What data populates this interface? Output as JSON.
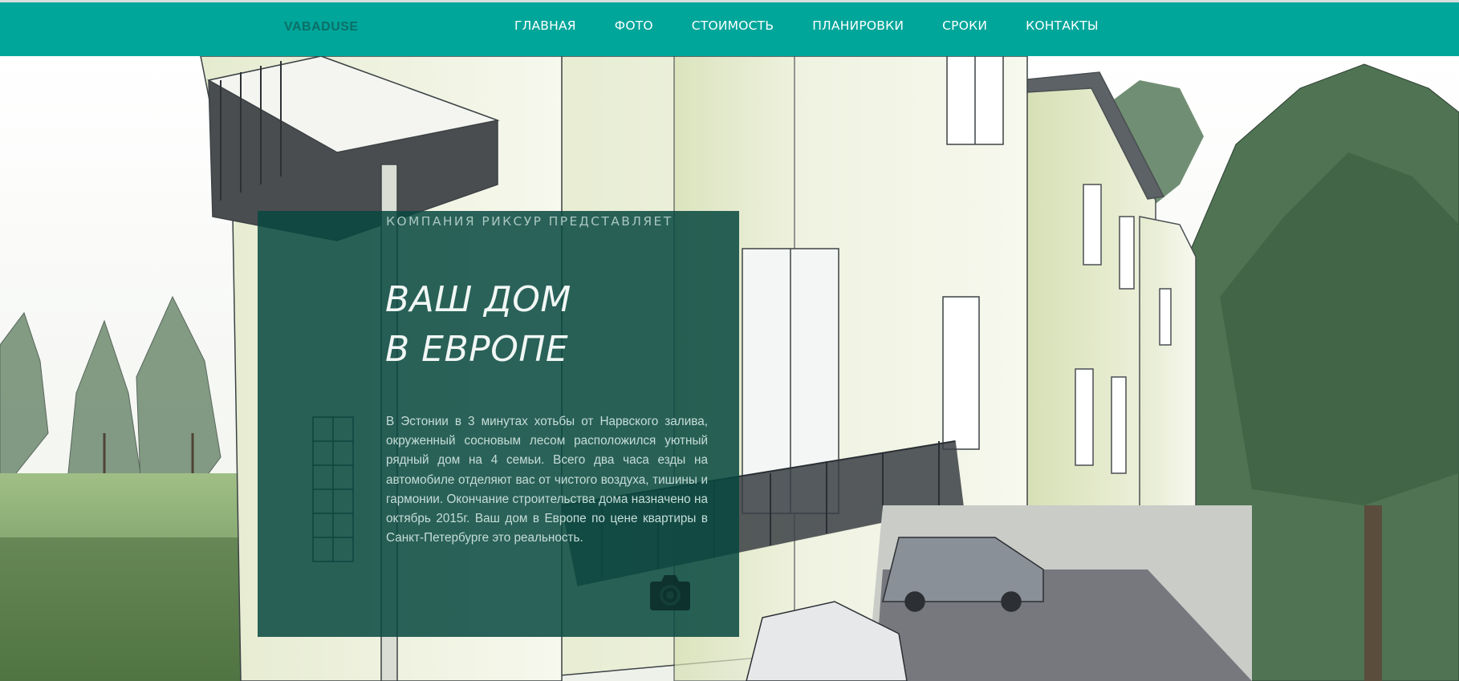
{
  "navbar": {
    "brand": "VABADUSE",
    "items": [
      {
        "label": "ГЛАВНАЯ"
      },
      {
        "label": "ФОТО"
      },
      {
        "label": "СТОИМОСТЬ"
      },
      {
        "label": "ПЛАНИРОВКИ"
      },
      {
        "label": "СРОКИ"
      },
      {
        "label": "КОНТАКТЫ"
      }
    ]
  },
  "hero": {
    "kicker": "КОМПАНИЯ РИКСУР ПРЕДСТАВЛЯЕТ",
    "headline_line1": "ВАШ ДОМ",
    "headline_line2": "В ЕВРОПЕ",
    "body": "В Эстонии в 3 минутах хотьбы от Нарвского залива, окруженный сосновым лесом расположился уютный рядный дом на 4 семьи. Всего два часа езды на автомобиле отделяют вас от чистого воздуха, тишины и гармонии. Окончание строительства дома назначено на октябрь 2015г. Ваш дом в Европе по цене квартиры в Санкт-Петербурге это реальность.",
    "camera_icon": "camera-icon"
  },
  "colors": {
    "navbar_bg": "#00a69a",
    "brand_text": "#0c6f68",
    "card_bg": "#084840"
  }
}
